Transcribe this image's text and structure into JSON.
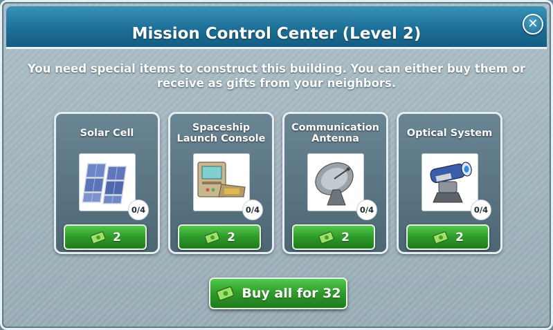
{
  "dialog": {
    "title": "Mission Control Center (Level 2)",
    "close_icon": "close-icon",
    "message": "You need special items to construct this building. You can either buy them or receive as gifts from your neighbors."
  },
  "items": [
    {
      "name": "Solar Cell",
      "icon": "solar-cell-icon",
      "count": "0/4",
      "price": "2"
    },
    {
      "name": "Spaceship Launch Console",
      "icon": "launch-console-icon",
      "count": "0/4",
      "price": "2"
    },
    {
      "name": "Communication Antenna",
      "icon": "antenna-icon",
      "count": "0/4",
      "price": "2"
    },
    {
      "name": "Optical System",
      "icon": "optical-system-icon",
      "count": "0/4",
      "price": "2"
    }
  ],
  "buy_all": {
    "label": "Buy all for 32",
    "icon": "cash-icon"
  },
  "colors": {
    "header": "#1d6f98",
    "button_green": "#2e9a2a",
    "card_bg": "#5a7583"
  }
}
